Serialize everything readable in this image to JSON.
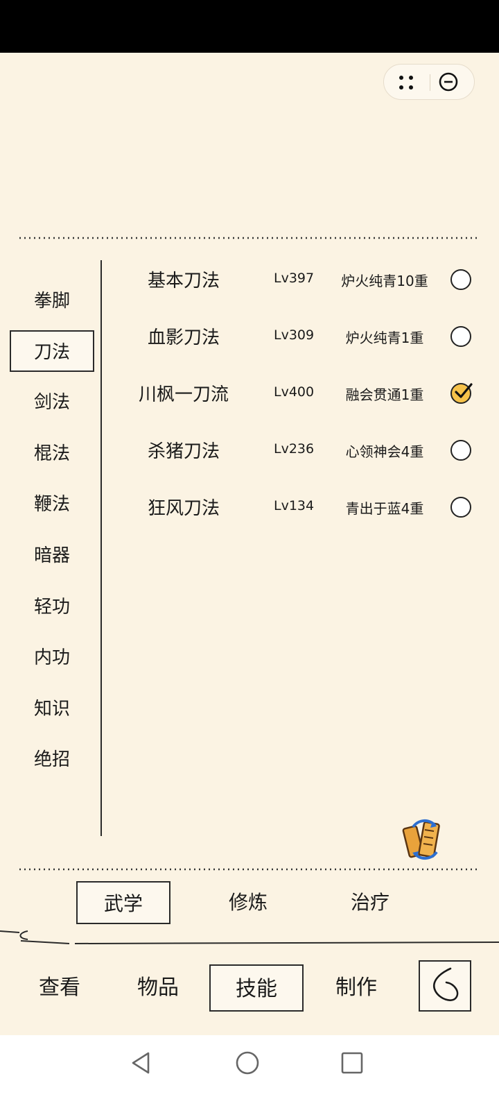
{
  "capsule": {
    "more_icon": "more-dots-icon",
    "close_icon": "minus-circle-icon"
  },
  "categories": [
    {
      "label": "拳脚",
      "active": false
    },
    {
      "label": "刀法",
      "active": true
    },
    {
      "label": "剑法",
      "active": false
    },
    {
      "label": "棍法",
      "active": false
    },
    {
      "label": "鞭法",
      "active": false
    },
    {
      "label": "暗器",
      "active": false
    },
    {
      "label": "轻功",
      "active": false
    },
    {
      "label": "内功",
      "active": false
    },
    {
      "label": "知识",
      "active": false
    },
    {
      "label": "绝招",
      "active": false
    }
  ],
  "skills": [
    {
      "name": "基本刀法",
      "level": "Lv397",
      "stage": "炉火纯青10重",
      "selected": false
    },
    {
      "name": "血影刀法",
      "level": "Lv309",
      "stage": "炉火纯青1重",
      "selected": false
    },
    {
      "name": "川枫一刀流",
      "level": "Lv400",
      "stage": "融会贯通1重",
      "selected": true
    },
    {
      "name": "杀猪刀法",
      "level": "Lv236",
      "stage": "心领神会4重",
      "selected": false
    },
    {
      "name": "狂风刀法",
      "level": "Lv134",
      "stage": "青出于蓝4重",
      "selected": false
    }
  ],
  "swap_icon": "switch-scroll-icon",
  "subtabs": [
    {
      "label": "武学",
      "active": true
    },
    {
      "label": "修炼",
      "active": false
    },
    {
      "label": "治疗",
      "active": false
    }
  ],
  "bottom_tabs": [
    {
      "label": "查看",
      "active": false
    },
    {
      "label": "物品",
      "active": false
    },
    {
      "label": "技能",
      "active": true
    },
    {
      "label": "制作",
      "active": false
    }
  ],
  "back_icon": "back-swirl-icon",
  "system_nav": {
    "back": "back-triangle-icon",
    "home": "home-circle-icon",
    "recents": "recents-square-icon"
  },
  "colors": {
    "background": "#fbf3e3",
    "accent": "#f6c24a",
    "ink": "#1a1a1a"
  }
}
